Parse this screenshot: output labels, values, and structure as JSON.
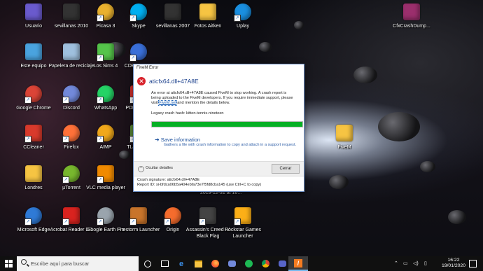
{
  "desktop": {
    "icons": [
      {
        "label": "Usuario",
        "icon": "user-folder-icon",
        "color": "#6a5acd"
      },
      {
        "label": "sevillanas 2010",
        "icon": "video-file-icon",
        "color": "#333"
      },
      {
        "label": "Picasa 3",
        "icon": "picasa-icon",
        "color": "#e9b12f"
      },
      {
        "label": "Skype",
        "icon": "skype-icon",
        "color": "#00aff0"
      },
      {
        "label": "sevillanas 2007",
        "icon": "video-file-icon",
        "color": "#333"
      },
      {
        "label": "Fotos Aitken",
        "icon": "folder-icon",
        "color": "#f6c443"
      },
      {
        "label": "Uplay",
        "icon": "uplay-icon",
        "color": "#1a8fe0"
      },
      {
        "label": "CfxCrashDump...",
        "icon": "archive-icon",
        "color": "#9b2f6d"
      },
      {
        "label": "Este equipo",
        "icon": "computer-icon",
        "color": "#4aa3df"
      },
      {
        "label": "Papelera de reciclaje",
        "icon": "recycle-bin-icon",
        "color": "#9fc0de"
      },
      {
        "label": "Los Sims 4",
        "icon": "sims-icon",
        "color": "#55c44a"
      },
      {
        "label": "CDBurnerXP",
        "icon": "disc-icon",
        "color": "#3a6fd8"
      },
      {
        "label": "Google Chrome",
        "icon": "chrome-icon",
        "color": "#db4437"
      },
      {
        "label": "Discord",
        "icon": "discord-icon",
        "color": "#7289da"
      },
      {
        "label": "WhatsApp",
        "icon": "whatsapp-icon",
        "color": "#25d366"
      },
      {
        "label": "PDFCreator",
        "icon": "pdfcreator-icon",
        "color": "#d9322f"
      },
      {
        "label": "CCleaner",
        "icon": "ccleaner-icon",
        "color": "#d93a2c"
      },
      {
        "label": "Firefox",
        "icon": "firefox-icon",
        "color": "#ff7139"
      },
      {
        "label": "AIMP",
        "icon": "aimp-icon",
        "color": "#f1a81b"
      },
      {
        "label": "TLauncher",
        "icon": "tlauncher-icon",
        "color": "#5b8b3a"
      },
      {
        "label": "FiveM",
        "icon": "fivem-folder-icon",
        "color": "#f6c443"
      },
      {
        "label": "Londres",
        "icon": "folder-icon",
        "color": "#f6c443"
      },
      {
        "label": "µTorrent",
        "icon": "utorrent-icon",
        "color": "#78b72e"
      },
      {
        "label": "VLC media player",
        "icon": "vlc-icon",
        "color": "#f08a00"
      },
      {
        "label": "Microsoft Edge",
        "icon": "edge-icon",
        "color": "#2f7ad6"
      },
      {
        "label": "Acrobat Reader DC",
        "icon": "acrobat-icon",
        "color": "#d9231f"
      },
      {
        "label": "Google Earth Pro",
        "icon": "google-earth-icon",
        "color": "#9aa4ad"
      },
      {
        "label": "Firestorm Launcher",
        "icon": "firestorm-icon",
        "color": "#c8742b"
      },
      {
        "label": "Origin",
        "icon": "origin-icon",
        "color": "#f56c2d"
      },
      {
        "label": "Assassin's Creed IV Black Flag",
        "icon": "assassins-creed-icon",
        "color": "#444"
      },
      {
        "label": "Rockstar Games Launcher",
        "icon": "rockstar-icon",
        "color": "#fcaf17"
      }
    ],
    "hidden_label": "2019-12-31 at 16..."
  },
  "dialog": {
    "window_title": "FiveM Error",
    "heading": "aticfx64.dll+47A8E",
    "body_text_1": "An error at aticfx64.dll+47A8E caused FiveM to stop working. A crash report is being uploaded to the FiveM developers. If you require immediate support, please visit ",
    "link_text": "FiveM.net",
    "body_text_2": " and mention the details below.",
    "legacy_hash": "Legacy crash hash: kitten-tennis-nineteen",
    "progress": 1.0,
    "save_title": "Save information",
    "save_desc": "Gathers a file with crash information to copy and attach in a support request.",
    "hide_details": "Ocultar detalles",
    "close_button": "Cerrar",
    "signature": "Crash signature: aticfx64.dll+47A8E",
    "report_id": "Report ID: si-bfdca06b5a404ebfa73e7f5fd8cba145 (use Ctrl+C to copy)"
  },
  "taskbar": {
    "search_placeholder": "Escribe aquí para buscar",
    "time": "16:22",
    "date": "19/01/2020"
  }
}
